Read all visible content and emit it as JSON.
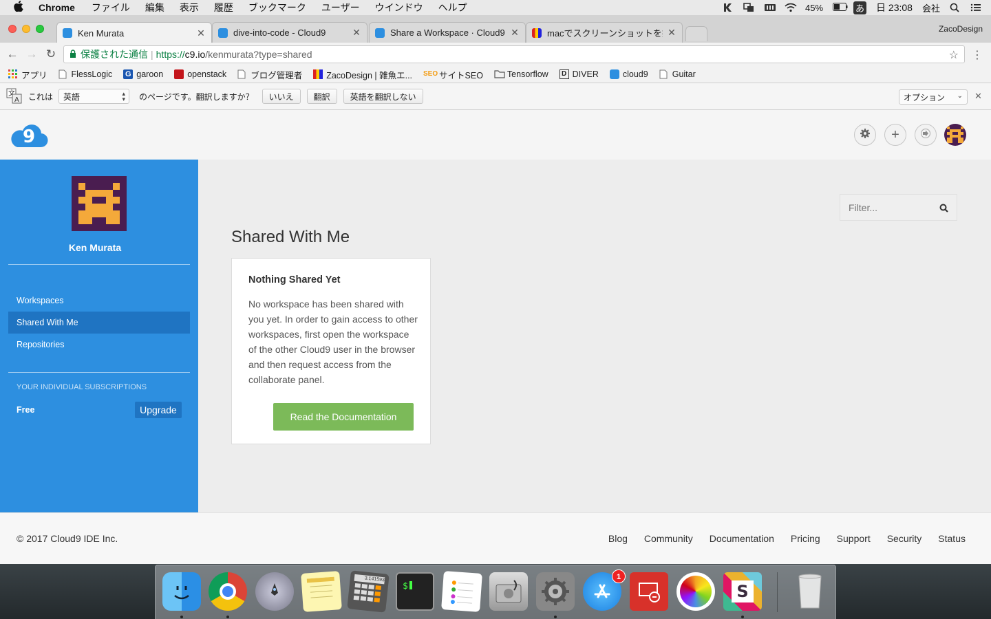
{
  "menubar": {
    "app_name": "Chrome",
    "items": [
      "ファイル",
      "編集",
      "表示",
      "履歴",
      "ブックマーク",
      "ユーザー",
      "ウインドウ",
      "ヘルプ"
    ],
    "battery": "45%",
    "ime": "あ",
    "clock": "日 23:08",
    "company": "会社"
  },
  "tabs": [
    {
      "title": "Ken Murata",
      "active": true
    },
    {
      "title": "dive-into-code - Cloud9",
      "active": false
    },
    {
      "title": "Share a Workspace · Cloud9",
      "active": false
    },
    {
      "title": "macでスクリーンショットを撮る",
      "active": false
    }
  ],
  "profile_name": "ZacoDesign",
  "omnibox": {
    "secure_label": "保護された通信",
    "url_scheme": "https://",
    "url_host": "c9.io",
    "url_path": "/kenmurata?type=shared"
  },
  "bookmarks": [
    {
      "label": "アプリ",
      "icon": "apps-grid-icon"
    },
    {
      "label": "FlessLogic",
      "icon": "page-icon"
    },
    {
      "label": "garoon",
      "icon": "garoon-icon"
    },
    {
      "label": "openstack",
      "icon": "openstack-icon"
    },
    {
      "label": "ブログ管理者",
      "icon": "page-icon"
    },
    {
      "label": "ZacoDesign | 雑魚エ...",
      "icon": "zacodesign-icon"
    },
    {
      "label": "サイトSEO",
      "icon": "seo-icon"
    },
    {
      "label": "Tensorflow",
      "icon": "folder-icon"
    },
    {
      "label": "DIVER",
      "icon": "diver-icon"
    },
    {
      "label": "cloud9",
      "icon": "cloud9-icon"
    },
    {
      "label": "Guitar",
      "icon": "page-icon"
    }
  ],
  "translate_bar": {
    "prefix": "これは",
    "language": "英語",
    "question": "のページです。翻訳しますか？",
    "no_button": "いいえ",
    "translate_button": "翻訳",
    "never_button": "英語を翻訳しない",
    "options": "オプション"
  },
  "sidebar": {
    "user_name": "Ken Murata",
    "nav": [
      {
        "label": "Workspaces",
        "active": false
      },
      {
        "label": "Shared With Me",
        "active": true
      },
      {
        "label": "Repositories",
        "active": false
      }
    ],
    "subscriptions_heading": "YOUR INDIVIDUAL SUBSCRIPTIONS",
    "plan": "Free",
    "upgrade_label": "Upgrade"
  },
  "main": {
    "filter_placeholder": "Filter...",
    "heading": "Shared With Me",
    "card_title": "Nothing Shared Yet",
    "card_body": "No workspace has been shared with you yet. In order to gain access to other workspaces, first open the workspace of the other Cloud9 user in the browser and then request access from the collaborate panel.",
    "card_button": "Read the Documentation"
  },
  "footer": {
    "copyright": "© 2017 Cloud9 IDE Inc.",
    "links": [
      "Blog",
      "Community",
      "Documentation",
      "Pricing",
      "Support",
      "Security",
      "Status"
    ]
  },
  "dock": {
    "apps": [
      "finder-icon",
      "chrome-icon",
      "launchpad-icon",
      "notes-icon",
      "calculator-icon",
      "terminal-icon",
      "reminders-icon",
      "disk-utility-icon",
      "system-preferences-icon",
      "app-store-icon",
      "remote-desktop-icon",
      "photos-icon",
      "slack-icon",
      "trash-icon"
    ],
    "app_store_badge": "1",
    "calculator_display": "3.141593"
  },
  "colors": {
    "sidebar": "#2d8fe0",
    "sidebar_active": "#1f74c2",
    "upgrade": "#1f74c2",
    "docs_button": "#7cba59",
    "avatar_bg": "#4a1d50",
    "avatar_fg": "#f4a93a"
  }
}
